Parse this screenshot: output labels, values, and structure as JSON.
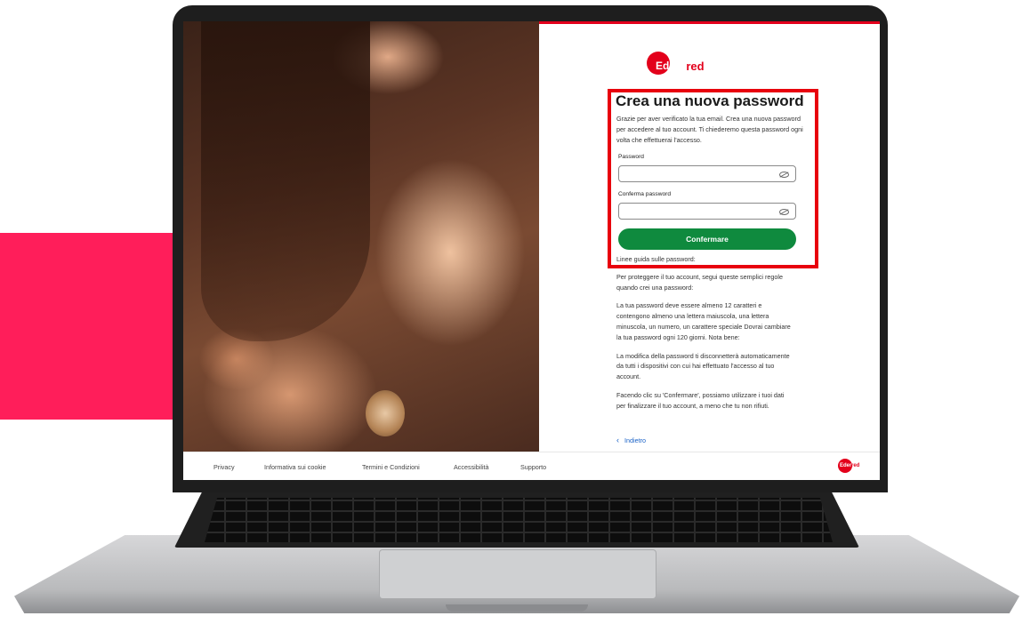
{
  "brand": {
    "logo_mark": "Eden",
    "logo_rest": "red",
    "accent_color": "#ff1e5a",
    "brand_red": "#e3001b",
    "button_green": "#0f8a3e",
    "link_blue": "#1a62c7"
  },
  "form": {
    "title": "Crea una nuova password",
    "intro": "Grazie per aver verificato la tua email. Crea una nuova password per accedere al tuo account. Ti chiederemo questa password ogni volta che effettuerai l'accesso.",
    "password_label": "Password",
    "password_value": "",
    "confirm_label": "Conferma password",
    "confirm_value": "",
    "submit_label": "Confermare"
  },
  "guidelines": {
    "heading": "Linee guida sulle password:",
    "p1": "Per proteggere il tuo account, segui queste semplici regole quando crei una password:",
    "p2": "La tua password deve essere almeno 12 caratteri e contengono almeno una lettera maiuscola, una lettera minuscola, un numero, un carattere speciale Dovrai cambiare la tua password ogni 120 giorni. Nota bene:",
    "p3": "La modifica della password ti disconnetterà automaticamente da tutti i dispositivi con cui hai effettuato l'accesso al tuo account.",
    "p4": "Facendo clic su 'Confermare', possiamo utilizzare i tuoi dati per finalizzare il tuo account, a meno che tu non rifiuti."
  },
  "back": {
    "icon": "chevron-left-icon",
    "label": "Indietro"
  },
  "footer": {
    "links": [
      "Privacy",
      "Informativa sui cookie",
      "Termini e Condizioni",
      "Accessibilità",
      "Supporto"
    ],
    "logo_mark": "Eden",
    "logo_rest": "red"
  }
}
